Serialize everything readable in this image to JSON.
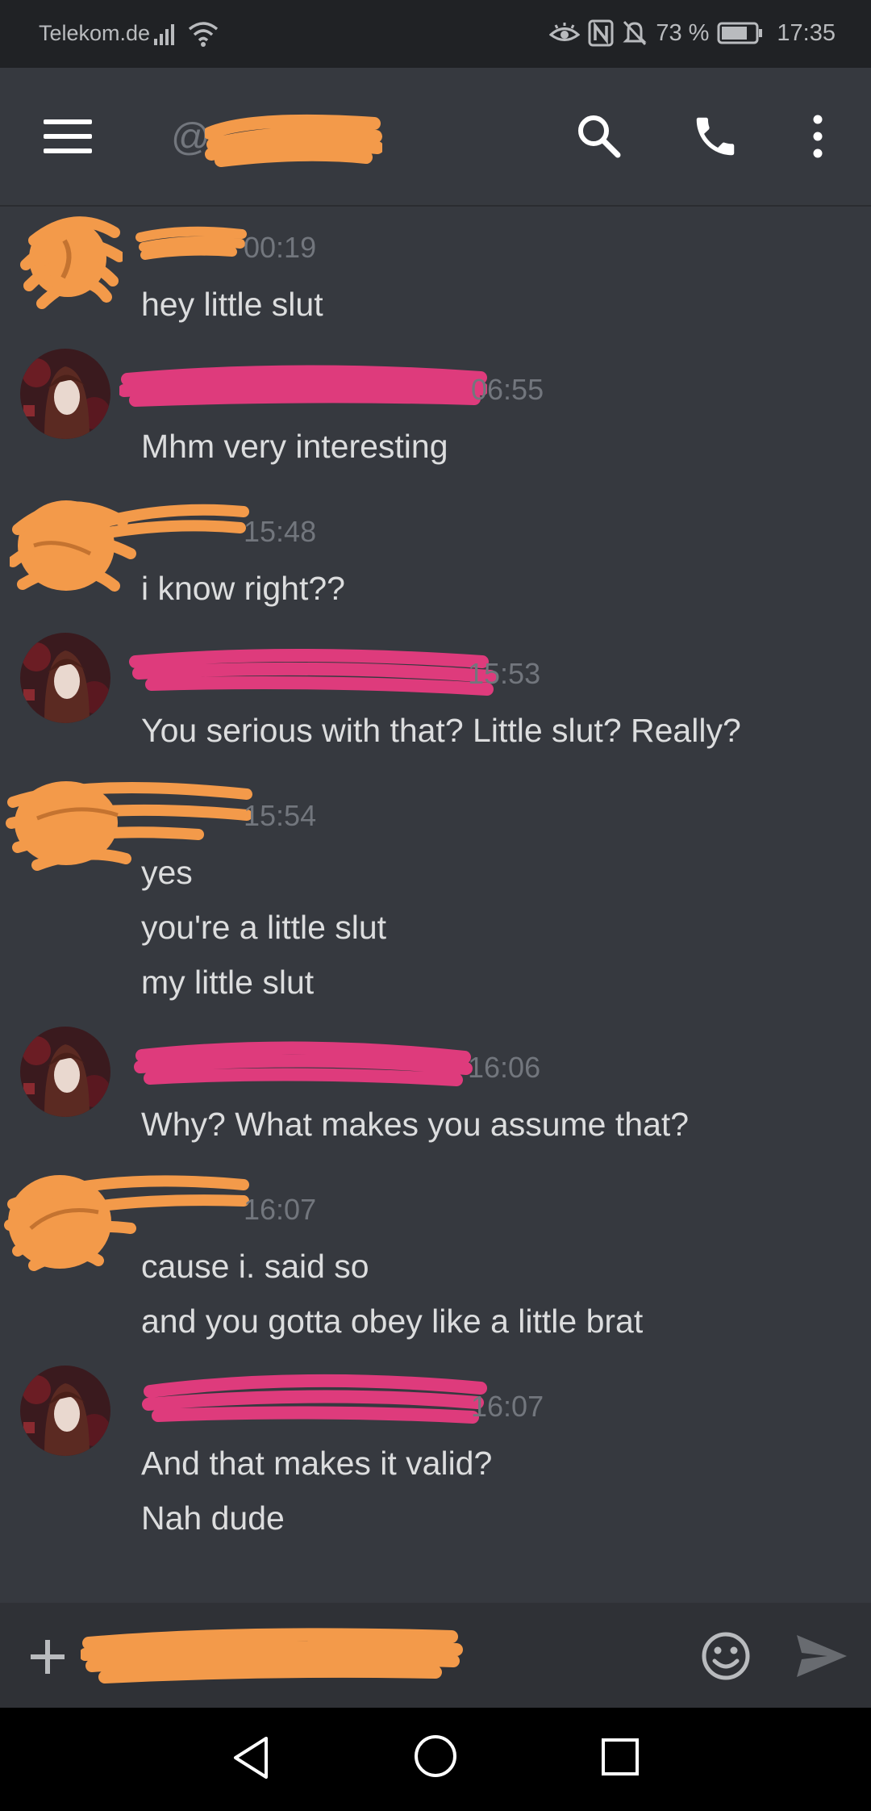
{
  "status_bar": {
    "carrier": "Telekom.de",
    "battery_percent": "73 %",
    "time": "17:35"
  },
  "header": {
    "at_sign": "@",
    "icons": [
      "menu-icon",
      "search-icon",
      "call-icon",
      "more-icon"
    ]
  },
  "colors": {
    "background": "#36393f",
    "statusbar": "#202225",
    "input_bar": "#2f3136",
    "scribble_orange": "#f39a4a",
    "scribble_pink": "#de3b7c",
    "timestamp": "#72767d",
    "text": "#dcddde"
  },
  "messages": [
    {
      "time": "00:19",
      "lines": [
        "hey little slut"
      ]
    },
    {
      "time": "06:55",
      "lines": [
        "Mhm very interesting"
      ]
    },
    {
      "time": "15:48",
      "lines": [
        "i know right??"
      ]
    },
    {
      "time": "15:53",
      "lines": [
        "You serious with that? Little slut? Really?"
      ]
    },
    {
      "time": "15:54",
      "lines": [
        "yes",
        "you're a little slut",
        "my little slut"
      ]
    },
    {
      "time": "16:06",
      "lines": [
        "Why? What makes you assume that?"
      ]
    },
    {
      "time": "16:07",
      "lines": [
        "cause i. said so",
        "and you gotta obey like a little brat"
      ]
    },
    {
      "time": "16:07",
      "lines": [
        "And that makes it valid?",
        "Nah dude"
      ]
    }
  ]
}
